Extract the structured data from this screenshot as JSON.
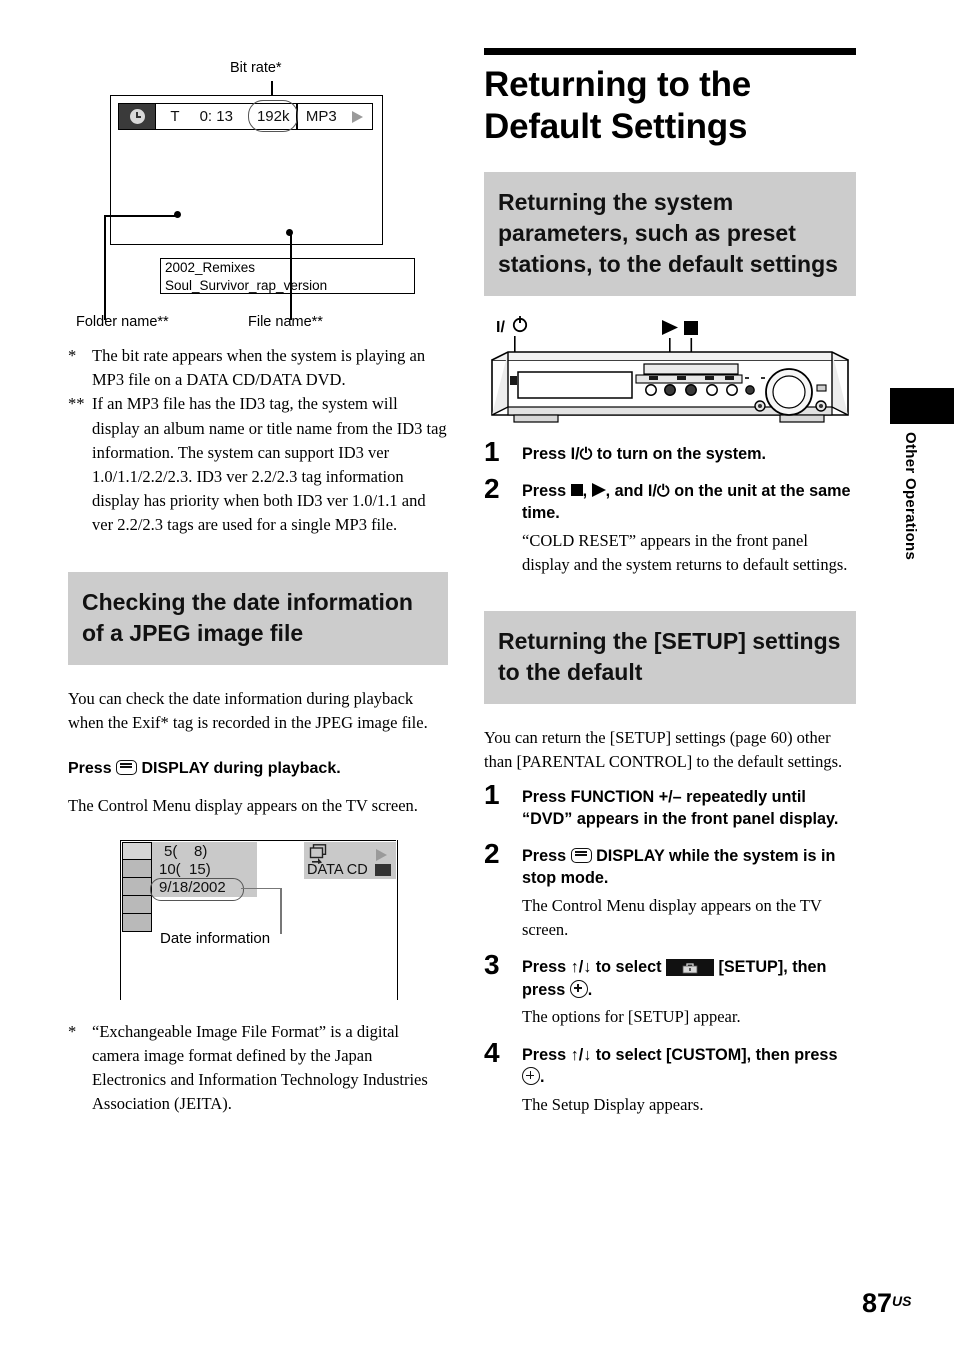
{
  "page": {
    "number": "87",
    "region_suffix": "US",
    "side_tab_label": "Other Operations"
  },
  "left_column": {
    "figure_mp3": {
      "bit_rate_caption": "Bit rate*",
      "osd": {
        "clock_icon": "clock-icon",
        "track_label": "T",
        "time": "0: 13",
        "bit_rate": "192k",
        "format": "MP3",
        "play_icon": "play-triangle-icon"
      },
      "folder_name": "2002_Remixes",
      "file_name": "Soul_Survivor_rap_version",
      "folder_caption": "Folder name**",
      "file_caption": "File name**"
    },
    "footnotes": [
      {
        "mark": "*",
        "text": "The bit rate appears when the system is playing an MP3 file on a DATA CD/DATA DVD."
      },
      {
        "mark": "**",
        "text": "If an MP3 file has the ID3 tag, the system will display an album name or title name from the ID3 tag information. The system can support ID3 ver 1.0/1.1/2.2/2.3. ID3 ver 2.2/2.3 tag information display has priority when both ID3 ver 1.0/1.1 and ver 2.2/2.3 tags are used for a single MP3 file."
      }
    ],
    "section_heading": "Checking the date information of a JPEG image file",
    "intro": "You can check the date information during playback when the Exif* tag is recorded in the JPEG image file.",
    "press_line_prefix": "Press",
    "press_line_suffix": "DISPLAY during playback.",
    "press_icon": "display-button-icon",
    "press_desc": "The Control Menu display appears on the TV screen.",
    "figure_date": {
      "line1": "5(    8)",
      "line2": "10(  15)",
      "line3": "9/18/2002",
      "disc_label": "DATA CD",
      "stack_icon": "multi-image-icon",
      "play_icon": "play-triangle-icon",
      "cd_icon": "media-icon",
      "callout": "Date information"
    },
    "footnote_exif": {
      "mark": "*",
      "text": "“Exchangeable Image File Format” is a digital camera image format defined by the Japan Electronics and Information Technology Industries Association (JEITA)."
    }
  },
  "right_column": {
    "title": "Returning to the Default Settings",
    "heading_1": "Returning the system parameters, such as preset stations, to the default settings",
    "device_figure": {
      "power_label": "I/⏻",
      "play_icon": "play-triangle-icon",
      "stop_icon": "stop-square-icon"
    },
    "steps_1": [
      {
        "num": "1",
        "head_pre": "Press",
        "head_icon": "power-icon",
        "head_post": "to turn on the system.",
        "desc": ""
      },
      {
        "num": "2",
        "head_pre": "Press",
        "head_icon": "stop-play-power-icons",
        "head_post": "on the unit at the same time.",
        "desc": "“COLD RESET” appears in the front panel display and the system returns to default settings."
      }
    ],
    "heading_2": "Returning the [SETUP] settings to the default",
    "intro_2": "You can return the [SETUP] settings (page 60) other than [PARENTAL CONTROL] to the default settings.",
    "steps_2": [
      {
        "num": "1",
        "head": "Press FUNCTION +/– repeatedly until “DVD” appears in the front panel display.",
        "desc": ""
      },
      {
        "num": "2",
        "head_pre": "Press",
        "head_icon": "display-button-icon",
        "head_post": "DISPLAY while the system is in stop mode.",
        "desc": "The Control Menu display appears on the TV screen."
      },
      {
        "num": "3",
        "head_pre": "Press ↑/↓ to select",
        "head_icon": "setup-toolbox-icon",
        "head_mid": "[SETUP], then press",
        "head_enter": "enter-button-icon",
        "head_post": ".",
        "desc": "The options for [SETUP] appear."
      },
      {
        "num": "4",
        "head_pre": "Press ↑/↓ to select [CUSTOM], then press",
        "head_enter": "enter-button-icon",
        "head_post": ".",
        "desc": "The Setup Display appears."
      }
    ]
  },
  "colors": {
    "gray_heading_bg": "#cccccc",
    "osd_panel_gray": "#c9c9c9",
    "ink": "#000000"
  }
}
